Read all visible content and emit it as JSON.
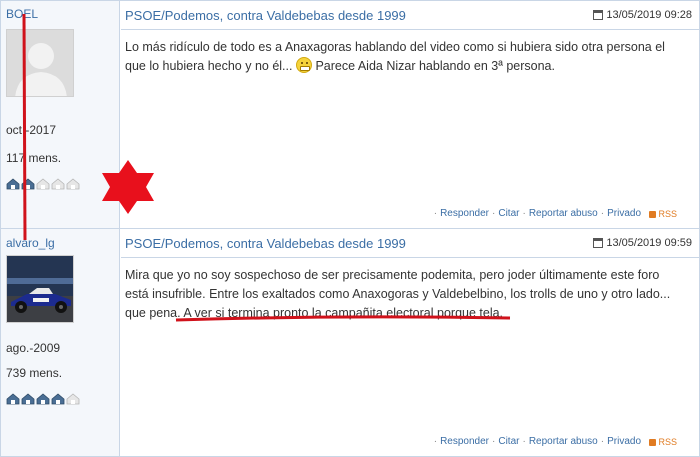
{
  "posts": [
    {
      "username": "BOEL",
      "join_date": "oct.-2017",
      "message_count": "117 mens.",
      "rank_filled": 2,
      "rank_total": 5,
      "title": "PSOE/Podemos, contra Valdebebas desde 1999",
      "date": "13/05/2019 09:28",
      "body_part1": "Lo más ridículo de todo es a Anaxagoras hablando del video como si hubiera sido otra persona el que lo hubiera hecho y no él...",
      "body_part2": "Parece Aida Nizar hablando en 3ª persona.",
      "emoji_icon": "grimace-emoji-icon"
    },
    {
      "username": "alvaro_lg",
      "join_date": "ago.-2009",
      "message_count": "739 mens.",
      "rank_filled": 4,
      "rank_total": 5,
      "title": "PSOE/Podemos, contra Valdebebas desde 1999",
      "date": "13/05/2019 09:59",
      "body_part1": "Mira que yo no soy sospechoso de ser precisamente podemita, pero joder últimamente este foro está insufrible. Entre los exaltados como Anaxogoras y Valdebelbino, los trolls de uno y otro lado... que pena.",
      "body_part2": "A ver si termina pronto la campañita electoral porque tela."
    }
  ],
  "actions": {
    "reply": "Responder",
    "quote": "Citar",
    "report": "Reportar abuso",
    "private": "Privado",
    "rss": "RSS"
  },
  "annotations": {
    "line_color": "#d0121b",
    "star_color": "#e8101c"
  }
}
